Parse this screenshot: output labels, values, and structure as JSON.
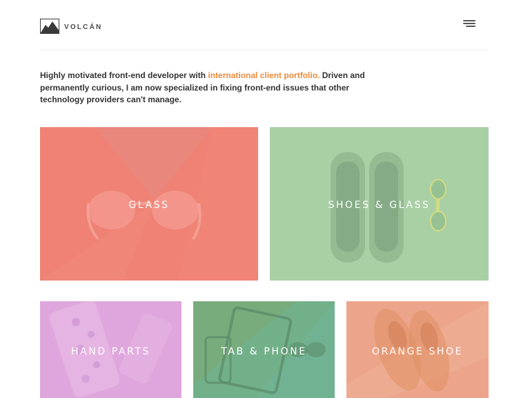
{
  "header": {
    "brand": "VOLCÁN",
    "logo_icon": "mountain-icon",
    "menu_icon": "hamburger-menu-icon"
  },
  "intro": {
    "before_link": "Highly motivated front-end developer with ",
    "link_text": "international client portfolio.",
    "after_link": " Driven and permanently curious, I am now specialized in fixing front-end issues that other technology providers can't manage."
  },
  "colors": {
    "accent": "#ee8a3c",
    "text": "#333333",
    "glass": "#ef8275",
    "shoes_glass": "#a9d0a5",
    "hand_parts": "#dea6dc",
    "tab_phone": "#72b08a",
    "orange_shoe": "#eca58a"
  },
  "portfolio": {
    "items": [
      {
        "label": "GLASS"
      },
      {
        "label": "SHOES & GLASS"
      },
      {
        "label": "HAND PARTS"
      },
      {
        "label": "TAB & PHONE"
      },
      {
        "label": "ORANGE SHOE"
      }
    ]
  }
}
